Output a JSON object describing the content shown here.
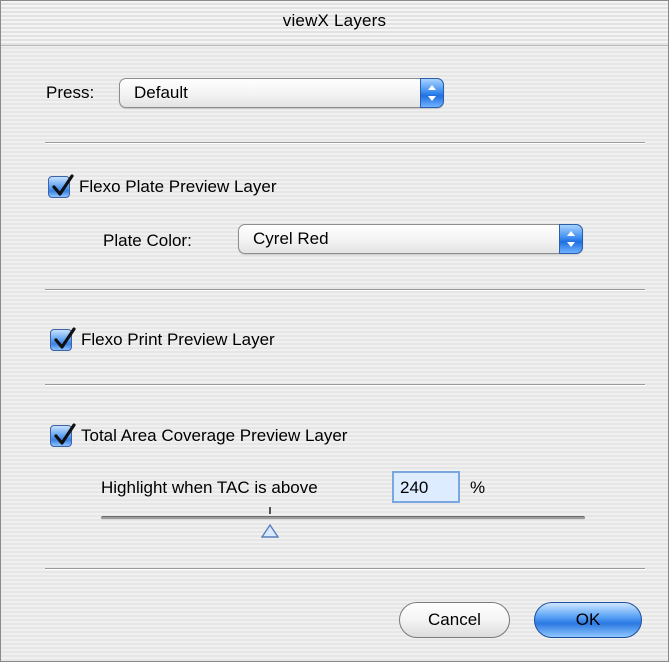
{
  "window": {
    "title": "viewX Layers"
  },
  "press": {
    "label": "Press:",
    "value": "Default"
  },
  "flexo_plate": {
    "label": "Flexo Plate Preview Layer",
    "checked": true,
    "plate_color_label": "Plate Color:",
    "plate_color_value": "Cyrel Red"
  },
  "flexo_print": {
    "label": "Flexo Print Preview Layer",
    "checked": true
  },
  "tac": {
    "label": "Total Area Coverage Preview Layer",
    "checked": true,
    "highlight_label": "Highlight when TAC is above",
    "value": "240",
    "unit": "%"
  },
  "buttons": {
    "cancel": "Cancel",
    "ok": "OK"
  },
  "colors": {
    "accent": "#3a82e4"
  }
}
